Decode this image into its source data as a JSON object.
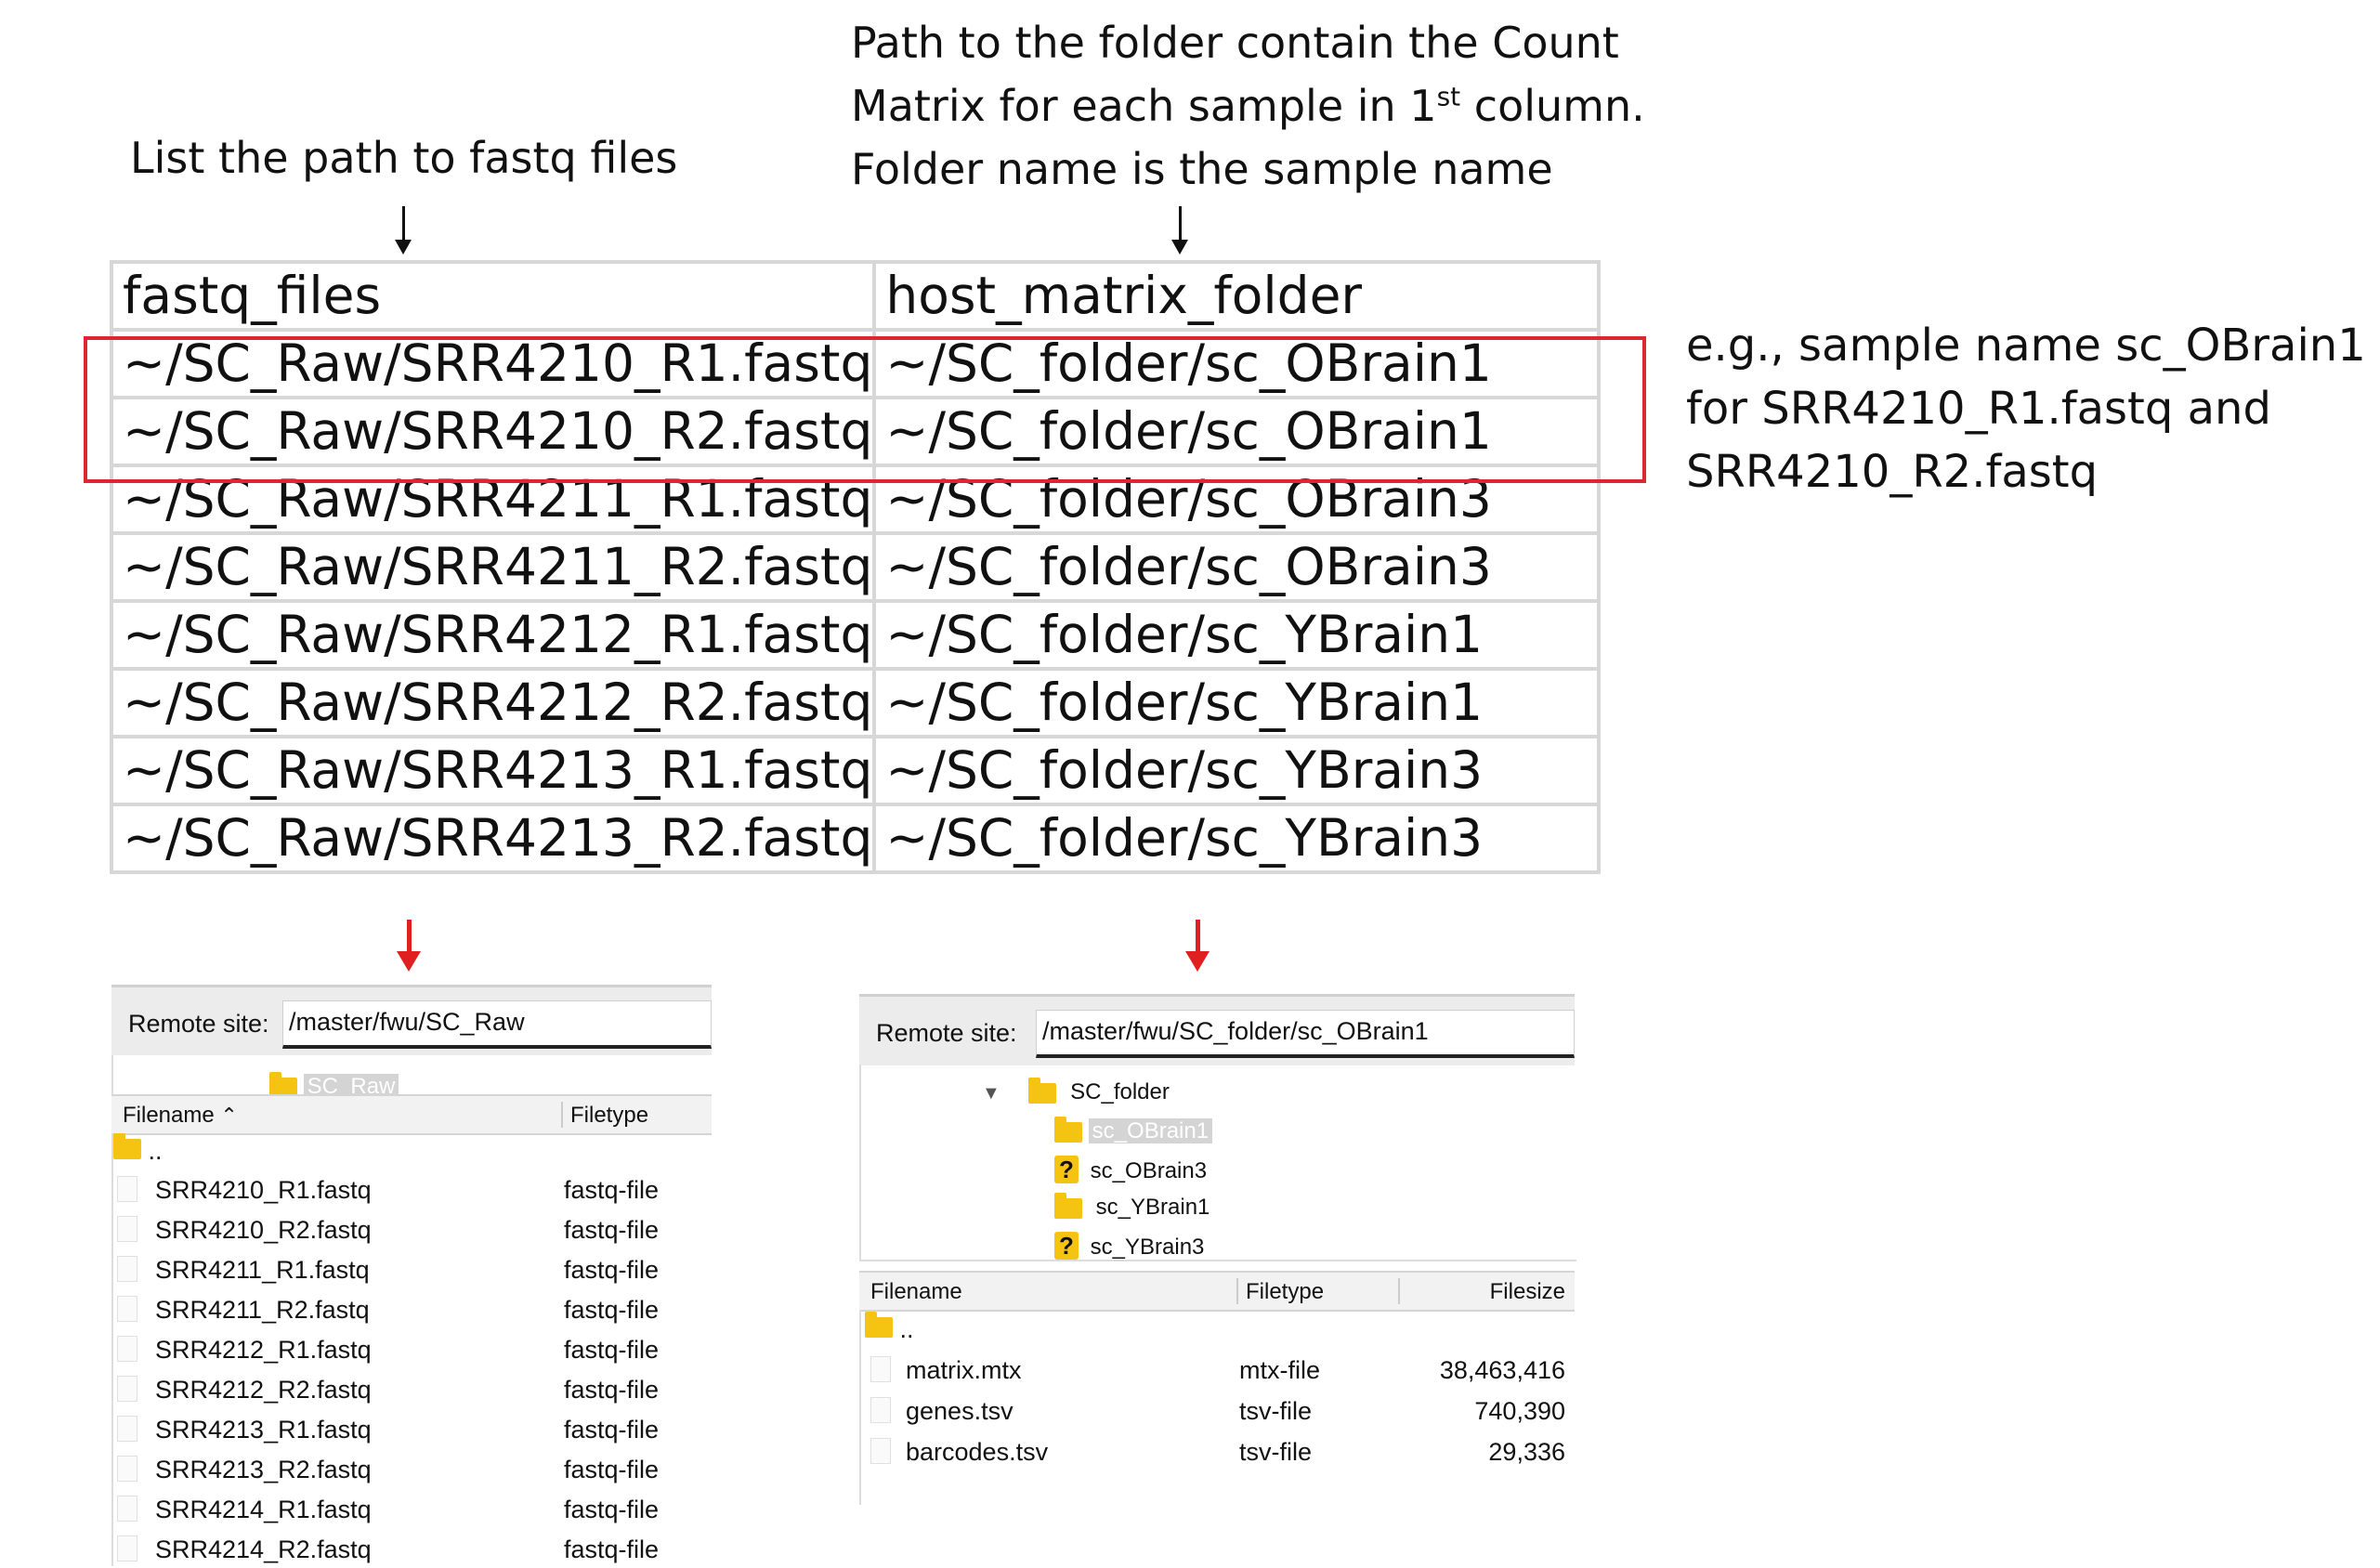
{
  "annotations": {
    "left_heading": "List the path to fastq files",
    "right_heading_line1": "Path to the folder contain the Count",
    "right_heading_line2_pre": "Matrix for each sample in 1",
    "right_heading_line2_sup": "st",
    "right_heading_line2_post": " column.",
    "right_heading_line3": "Folder name is the sample name",
    "side_note_line1": "e.g., sample name sc_OBrain1",
    "side_note_line2": "for SRR4210_R1.fastq and",
    "side_note_line3": "SRR4210_R2.fastq"
  },
  "sheet": {
    "headers": [
      "fastq_files",
      "host_matrix_folder"
    ],
    "rows": [
      [
        "~/SC_Raw/SRR4210_R1.fastq",
        "~/SC_folder/sc_OBrain1"
      ],
      [
        "~/SC_Raw/SRR4210_R2.fastq",
        "~/SC_folder/sc_OBrain1"
      ],
      [
        "~/SC_Raw/SRR4211_R1.fastq",
        "~/SC_folder/sc_OBrain3"
      ],
      [
        "~/SC_Raw/SRR4211_R2.fastq",
        "~/SC_folder/sc_OBrain3"
      ],
      [
        "~/SC_Raw/SRR4212_R1.fastq",
        "~/SC_folder/sc_YBrain1"
      ],
      [
        "~/SC_Raw/SRR4212_R2.fastq",
        "~/SC_folder/sc_YBrain1"
      ],
      [
        "~/SC_Raw/SRR4213_R1.fastq",
        "~/SC_folder/sc_YBrain3"
      ],
      [
        "~/SC_Raw/SRR4213_R2.fastq",
        "~/SC_folder/sc_YBrain3"
      ]
    ]
  },
  "left_panel": {
    "site_label": "Remote site:",
    "site_path": "/master/fwu/SC_Raw",
    "tree_folder": "SC_Raw",
    "col_filename": "Filename",
    "col_filetype": "Filetype",
    "parent": "..",
    "files": [
      {
        "name": "SRR4210_R1.fastq",
        "type": "fastq-file"
      },
      {
        "name": "SRR4210_R2.fastq",
        "type": "fastq-file"
      },
      {
        "name": "SRR4211_R1.fastq",
        "type": "fastq-file"
      },
      {
        "name": "SRR4211_R2.fastq",
        "type": "fastq-file"
      },
      {
        "name": "SRR4212_R1.fastq",
        "type": "fastq-file"
      },
      {
        "name": "SRR4212_R2.fastq",
        "type": "fastq-file"
      },
      {
        "name": "SRR4213_R1.fastq",
        "type": "fastq-file"
      },
      {
        "name": "SRR4213_R2.fastq",
        "type": "fastq-file"
      },
      {
        "name": "SRR4214_R1.fastq",
        "type": "fastq-file"
      },
      {
        "name": "SRR4214_R2.fastq",
        "type": "fastq-file"
      }
    ]
  },
  "right_panel": {
    "site_label": "Remote site:",
    "site_path": "/master/fwu/SC_folder/sc_OBrain1",
    "tree_root": "SC_folder",
    "tree_items": [
      "sc_OBrain1",
      "sc_OBrain3",
      "sc_YBrain1",
      "sc_YBrain3"
    ],
    "col_filename": "Filename",
    "col_filetype": "Filetype",
    "col_filesize": "Filesize",
    "parent": "..",
    "files": [
      {
        "name": "matrix.mtx",
        "type": "mtx-file",
        "size": "38,463,416"
      },
      {
        "name": "genes.tsv",
        "type": "tsv-file",
        "size": "740,390"
      },
      {
        "name": "barcodes.tsv",
        "type": "tsv-file",
        "size": "29,336"
      }
    ]
  },
  "colors": {
    "highlight_red": "#d9282f",
    "arrow_red": "#e02020",
    "folder_yellow": "#f5c311"
  }
}
